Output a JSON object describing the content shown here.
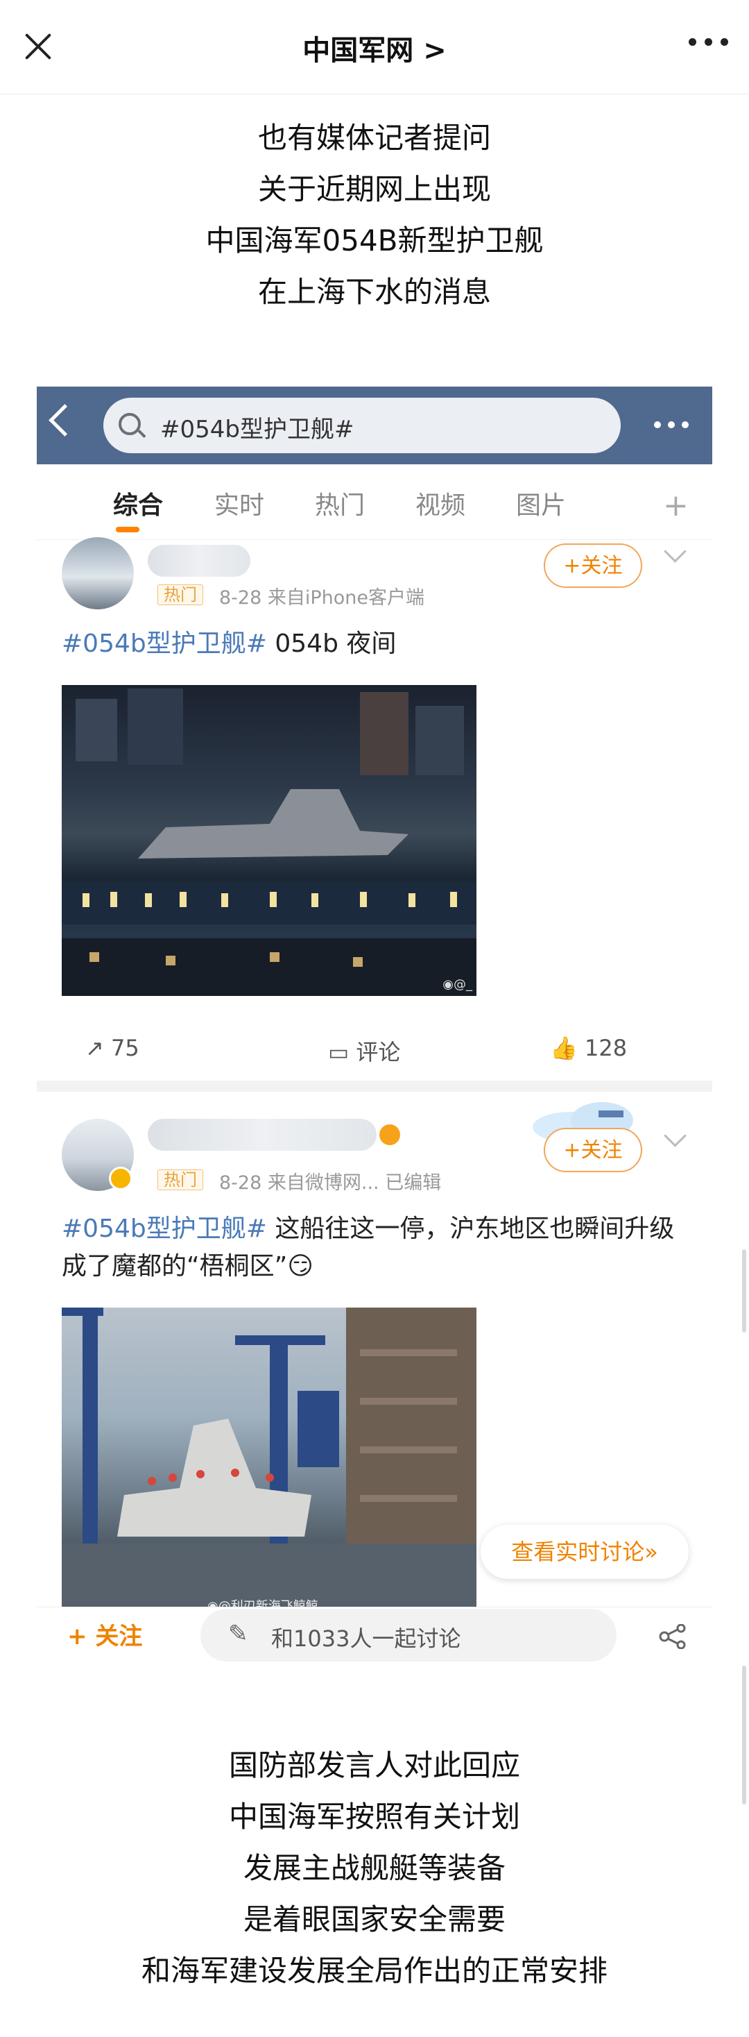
{
  "topbar": {
    "title": "中国军网 >"
  },
  "article_top": [
    "也有媒体记者提问",
    "关于近期网上出现",
    "中国海军054B新型护卫舰",
    "在上海下水的消息"
  ],
  "embed": {
    "search_text": "#054b型护卫舰#",
    "tabs": [
      "综合",
      "实时",
      "热门",
      "视频",
      "图片"
    ],
    "post1": {
      "badge": "热门",
      "meta": "8-28  来自iPhone客户端",
      "follow": "+关注",
      "topic": "#054b型护卫舰#",
      "text": " 054b 夜间",
      "watermark": "◉@_",
      "reposts": "75",
      "comments": "评论",
      "likes": "128"
    },
    "post2": {
      "badge": "热门",
      "meta": "8-28  来自微博网... 已编辑",
      "follow": "+关注",
      "topic": "#054b型护卫舰#",
      "text": " 这船往这一停，沪东地区也瞬间升级成了魔都的“梧桐区”",
      "emoji": "😏",
      "watermark": "◉@利刃新海飞鲸鲸"
    },
    "realtime_button": "查看实时讨论»",
    "bottom": {
      "follow": "+ 关注",
      "discuss": "和1033人一起讨论"
    }
  },
  "article_bottom": [
    "国防部发言人对此回应",
    "中国海军按照有关计划",
    "发展主战舰艇等装备",
    "是着眼国家安全需要",
    "和海军建设发展全局作出的正常安排"
  ]
}
